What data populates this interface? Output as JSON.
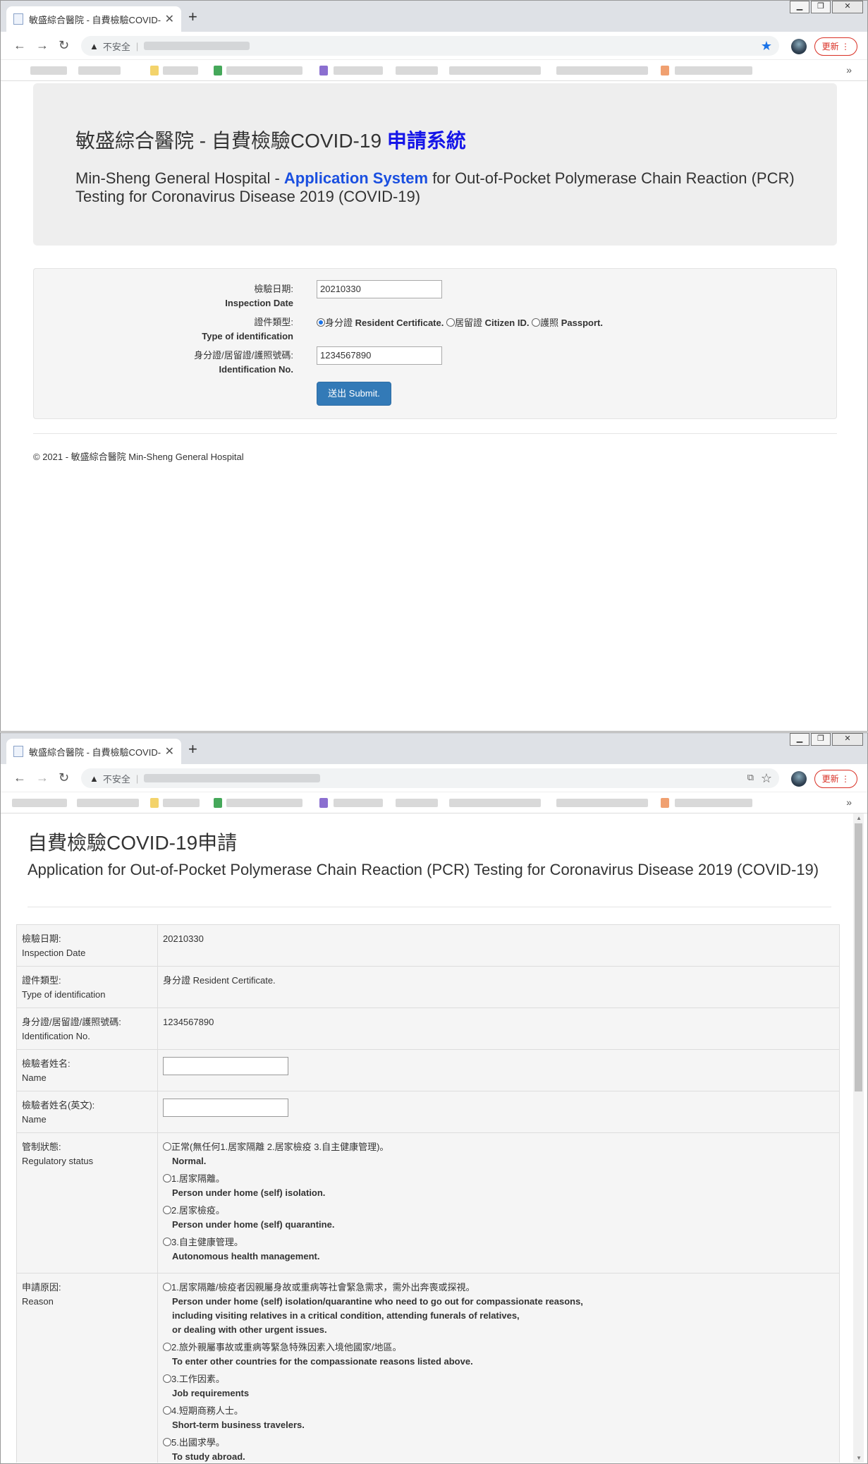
{
  "window1": {
    "tab_title": "敏盛綜合醫院 - 自費檢驗COVID-",
    "address": {
      "warning_label": "不安全"
    },
    "update_button": "更新",
    "jumbotron": {
      "title_prefix": "敏盛綜合醫院 - 自費檢驗COVID-19 ",
      "title_highlight": "申請系統",
      "subtitle_prefix": "Min-Sheng General Hospital - ",
      "subtitle_highlight": "Application System",
      "subtitle_suffix": " for Out-of-Pocket Polymerase Chain Reaction (PCR) Testing for Coronavirus Disease 2019 (COVID-19)"
    },
    "form": {
      "date_label_zh": "檢驗日期:",
      "date_label_en": "Inspection Date",
      "date_value": "20210330",
      "idtype_label_zh": "證件類型:",
      "idtype_label_en": "Type of identification",
      "idtype_options": [
        {
          "zh": "身分證",
          "en": "Resident Certificate.",
          "selected": true
        },
        {
          "zh": "居留證",
          "en": "Citizen ID.",
          "selected": false
        },
        {
          "zh": "護照",
          "en": "Passport.",
          "selected": false
        }
      ],
      "idno_label_zh": "身分證/居留證/護照號碼:",
      "idno_label_en": "Identification No.",
      "idno_value": "1234567890",
      "submit_label": "送出 Submit."
    },
    "footer": "© 2021 - 敏盛綜合醫院 Min-Sheng General Hospital"
  },
  "window2": {
    "tab_title": "敏盛綜合醫院 - 自費檢驗COVID-",
    "address": {
      "warning_label": "不安全"
    },
    "update_button": "更新",
    "heading_zh": "自費檢驗COVID-19申請",
    "heading_en": "Application for Out-of-Pocket Polymerase Chain Reaction (PCR) Testing for Coronavirus Disease 2019 (COVID-19)",
    "rows": {
      "date": {
        "label_zh": "檢驗日期:",
        "label_en": "Inspection Date",
        "value": "20210330"
      },
      "idtype": {
        "label_zh": "證件類型:",
        "label_en": "Type of identification",
        "value": "身分證 Resident Certificate."
      },
      "idno": {
        "label_zh": "身分證/居留證/護照號碼:",
        "label_en": "Identification No.",
        "value": "1234567890"
      },
      "name": {
        "label_zh": "檢驗者姓名:",
        "label_en": "Name"
      },
      "name_en": {
        "label_zh": "檢驗者姓名(英文):",
        "label_en": "Name"
      },
      "regulatory": {
        "label_zh": "管制狀態:",
        "label_en": "Regulatory status",
        "options": [
          {
            "zh": "正常(無任何1.居家隔離 2.居家檢疫 3.自主健康管理)。",
            "en": "Normal."
          },
          {
            "zh": "1.居家隔離。",
            "en": "Person under home (self) isolation."
          },
          {
            "zh": "2.居家檢疫。",
            "en": "Person under home (self) quarantine."
          },
          {
            "zh": "3.自主健康管理。",
            "en": "Autonomous health management."
          }
        ]
      },
      "reason": {
        "label_zh": "申請原因:",
        "label_en": "Reason",
        "options": [
          {
            "zh": "1.居家隔離/檢疫者因親屬身故或重病等社會緊急需求，需外出奔喪或探視。",
            "en_lines": [
              "Person under home (self) isolation/quarantine who need to go out for compassionate reasons,",
              "including visiting relatives in a critical condition, attending funerals of relatives,",
              "or dealing with other urgent issues."
            ]
          },
          {
            "zh": "2.旅外親屬事故或重病等緊急特殊因素入境他國家/地區。",
            "en_lines": [
              "To enter other countries for the compassionate reasons listed above."
            ]
          },
          {
            "zh": "3.工作因素。",
            "en_lines": [
              "Job requirements"
            ]
          },
          {
            "zh": "4.短期商務人士。",
            "en_lines": [
              "Short-term business travelers."
            ]
          },
          {
            "zh": "5.出國求學。",
            "en_lines": [
              "To study abroad."
            ]
          }
        ]
      }
    }
  }
}
